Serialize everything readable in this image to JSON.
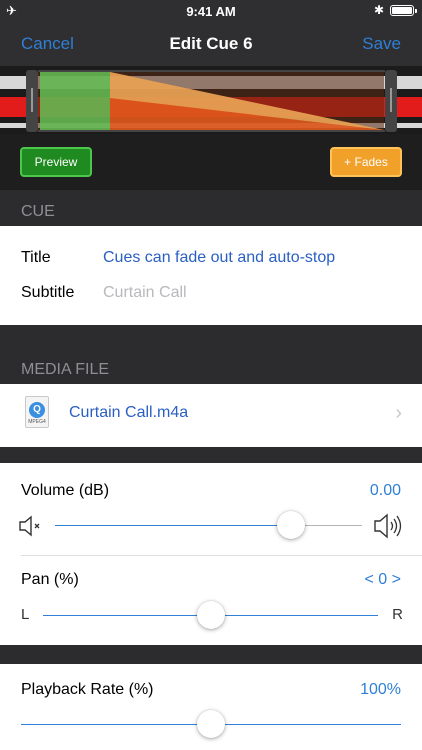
{
  "status": {
    "time": "9:41 AM",
    "airplane_icon": "airplane-icon",
    "bluetooth_icon": "bluetooth-icon",
    "battery_icon": "battery-icon"
  },
  "nav": {
    "cancel_label": "Cancel",
    "title": "Edit Cue 6",
    "save_label": "Save"
  },
  "colors": {
    "accent": "#2f7fd6",
    "preview": "#1f8a1f",
    "fades": "#f1a02a",
    "wave_red": "#e21b1b",
    "wave_green": "#7cd46a",
    "wave_yellow": "#f0d27a"
  },
  "waveform": {
    "preview_label": "Preview",
    "fades_label": "+ Fades"
  },
  "cue_section": {
    "header": "CUE",
    "title_label": "Title",
    "title_value": "Cues can fade out and auto-stop",
    "subtitle_label": "Subtitle",
    "subtitle_placeholder": "Curtain Call"
  },
  "media_section": {
    "header": "MEDIA FILE",
    "file_name": "Curtain Call.m4a",
    "file_icon": "mpeg4-file-icon",
    "file_icon_ext": "MPEG4"
  },
  "audio": {
    "volume_label": "Volume (dB)",
    "volume_value": "0.00",
    "volume_level": 0.77,
    "mute_icon": "speaker-mute-icon",
    "loud_icon": "speaker-loud-icon",
    "pan_label": "Pan (%)",
    "pan_value": "< 0 >",
    "pan_level": 0.5,
    "pan_left": "L",
    "pan_right": "R"
  },
  "rate": {
    "label": "Playback Rate (%)",
    "value": "100%",
    "level": 0.5
  }
}
